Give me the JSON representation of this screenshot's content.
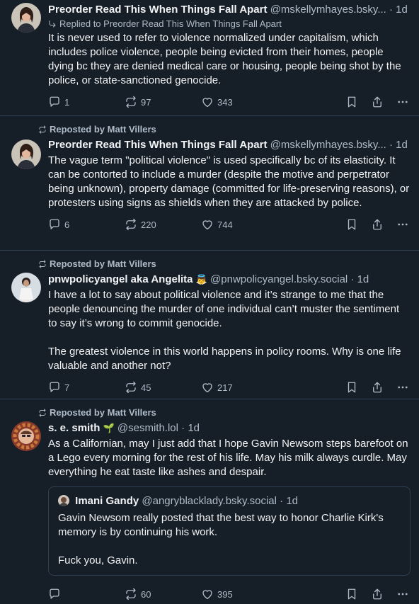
{
  "posts": [
    {
      "reposted_by": "",
      "name": "Preorder Read This When Things Fall Apart",
      "handle": "@mskellymhayes.bsky...",
      "time": "1d",
      "replied_to": "Replied to Preorder Read This When Things Fall Apart",
      "text": "It is never used to refer to violence normalized under capitalism, which includes police violence, people being evicted from their homes, people dying bc they are denied medical care or housing, people being shot by the police, or state-sanctioned genocide.",
      "replies": "1",
      "reposts": "97",
      "likes": "343"
    },
    {
      "reposted_by": "Reposted by Matt Villers",
      "name": "Preorder Read This When Things Fall Apart",
      "handle": "@mskellymhayes.bsky...",
      "time": "1d",
      "text": "The vague term \"political violence\" is used specifically bc of its elasticity. It can be contorted to include a murder (despite the motive and perpetrator being unknown), property damage (committed for life-preserving reasons), or protesters using signs as shields when they are attacked by police.",
      "replies": "6",
      "reposts": "220",
      "likes": "744"
    },
    {
      "reposted_by": "Reposted by Matt Villers",
      "name": "pnwpolicyangel aka Angelita",
      "name_emoji": "👼",
      "handle": "@pnwpolicyangel.bsky.social",
      "time": "1d",
      "text": "I have a lot to say about political violence and it’s strange to me that the people denouncing the murder of one individual can’t muster the sentiment to say it’s wrong to commit genocide.\n\nThe greatest violence in this world happens in policy rooms. Why is one life valuable and another not?",
      "replies": "7",
      "reposts": "45",
      "likes": "217"
    },
    {
      "reposted_by": "Reposted by Matt Villers",
      "name": "s. e. smith",
      "name_emoji": "🌱",
      "handle": "@sesmith.lol",
      "time": "1d",
      "text": "As a Californian, may I just add that I hope Gavin Newsom steps barefoot on a Lego every morning for the rest of his life. May his milk always curdle. May everything he eat taste like ashes and despair.",
      "quote": {
        "name": "Imani Gandy",
        "handle": "@angryblacklady.bsky.social",
        "time": "1d",
        "text": "Gavin Newsom really posted that the best way to honor Charlie Kirk's memory is by continuing his work.\n\nFuck you, Gavin."
      },
      "replies": "",
      "reposts": "60",
      "likes": "395"
    }
  ],
  "separator": "·"
}
